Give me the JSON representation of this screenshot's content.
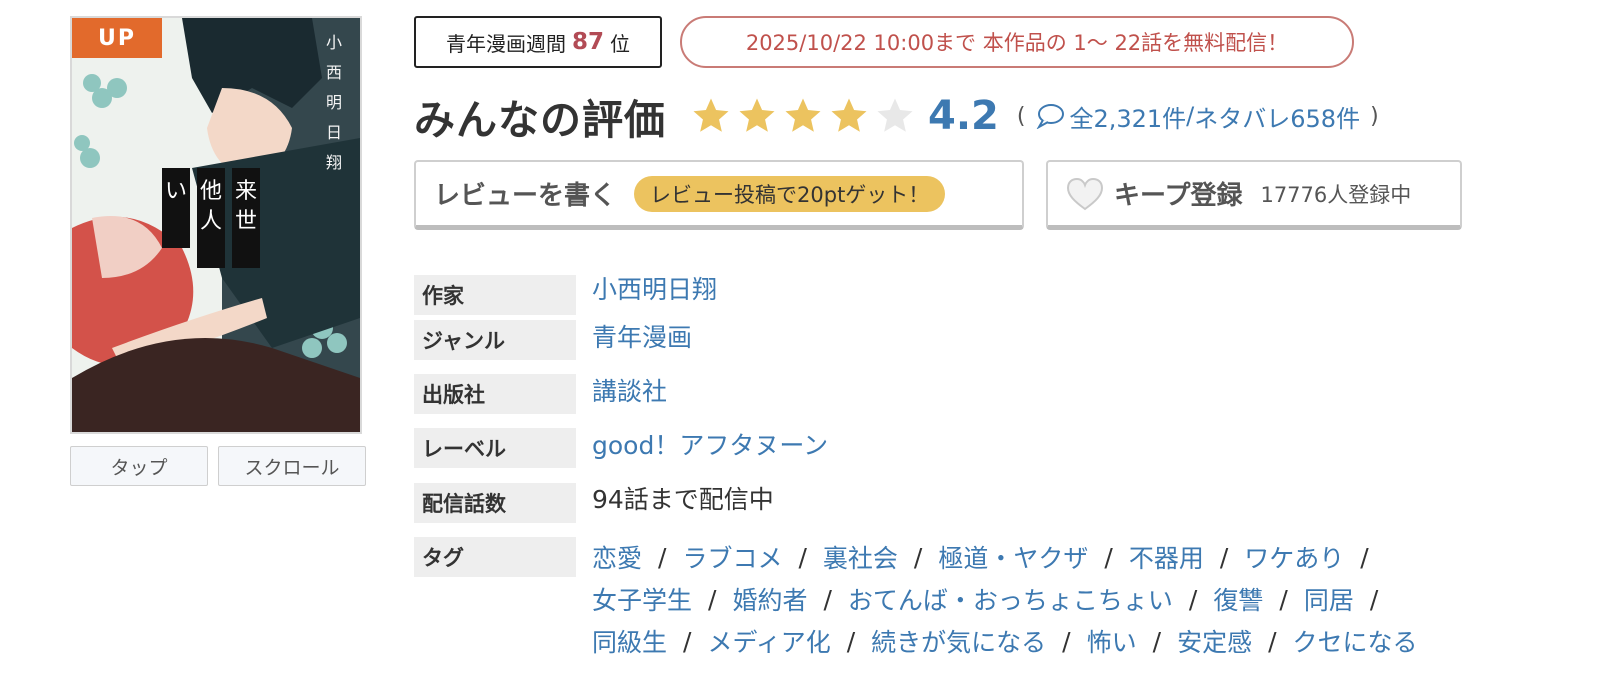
{
  "cover": {
    "up_badge": "UP",
    "author_vertical": "小西明日翔",
    "title_vertical": "来世は他人がいい",
    "colors": {
      "badge": "#e26a2c",
      "hair": "#d3524a",
      "suit": "#1f3338"
    }
  },
  "view_buttons": {
    "tap": "タップ",
    "scroll": "スクロール"
  },
  "ranking": {
    "prefix": "青年漫画週間",
    "rank": "87",
    "suffix": "位"
  },
  "free_notice": "2025/10/22 10:00まで 本作品の 1〜 22話を無料配信！",
  "rating": {
    "title": "みんなの評価",
    "stars_filled": 4,
    "stars_total": 5,
    "score": "4.2",
    "open_paren": "(",
    "reviews": "全2,321件",
    "separator": "/",
    "spoilers": "ネタバレ658件",
    "close_paren": ")",
    "icon": "speech-bubble-icon"
  },
  "review_button": {
    "label": "レビューを書く",
    "promo": "レビュー投稿で20ptゲット！"
  },
  "keep_button": {
    "label": "キープ登録",
    "count": "17776人登録中",
    "icon": "heart-icon"
  },
  "info": {
    "author": {
      "label": "作家",
      "value": "小西明日翔"
    },
    "genre": {
      "label": "ジャンル",
      "value": "青年漫画"
    },
    "publisher": {
      "label": "出版社",
      "value": "講談社"
    },
    "imprint": {
      "label": "レーベル",
      "value": "good！アフタヌーン"
    },
    "episodes": {
      "label": "配信話数",
      "value": "94話まで配信中"
    },
    "tags": {
      "label": "タグ",
      "separator": "/",
      "lines": [
        [
          "恋愛",
          "ラブコメ",
          "裏社会",
          "極道・ヤクザ",
          "不器用",
          "ワケあり"
        ],
        [
          "女子学生",
          "婚約者",
          "おてんば・おっちょこちょい",
          "復讐",
          "同居"
        ],
        [
          "同級生",
          "メディア化",
          "続きが気になる",
          "怖い",
          "安定感",
          "クセになる"
        ]
      ]
    }
  },
  "colors": {
    "link": "#3d79b1",
    "accent_red": "#b24b55",
    "star": "#ecc35f",
    "star_empty": "#e8e8e8"
  }
}
